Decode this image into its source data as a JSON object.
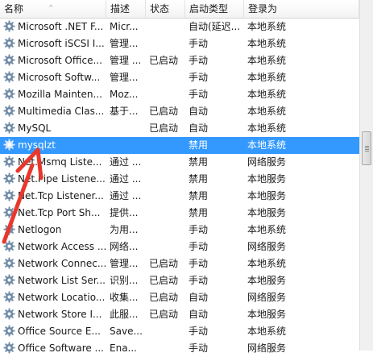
{
  "header": {
    "columns": [
      "名称",
      "描述",
      "状态",
      "启动类型",
      "登录为"
    ],
    "sort_indicator": "^"
  },
  "services": [
    {
      "name": "Microsoft .NET F...",
      "desc": "Micr...",
      "status": "",
      "startup": "自动(延迟...",
      "logon": "本地系统"
    },
    {
      "name": "Microsoft iSCSI I...",
      "desc": "管理...",
      "status": "",
      "startup": "手动",
      "logon": "本地系统"
    },
    {
      "name": "Microsoft Office...",
      "desc": "管理 ...",
      "status": "已启动",
      "startup": "手动",
      "logon": "本地系统"
    },
    {
      "name": "Microsoft Softw...",
      "desc": "管理...",
      "status": "",
      "startup": "手动",
      "logon": "本地系统"
    },
    {
      "name": "Mozilla Mainten...",
      "desc": "Moz...",
      "status": "",
      "startup": "手动",
      "logon": "本地系统"
    },
    {
      "name": "Multimedia Clas...",
      "desc": "基于...",
      "status": "已启动",
      "startup": "自动",
      "logon": "本地系统"
    },
    {
      "name": "MySQL",
      "desc": "",
      "status": "已启动",
      "startup": "自动",
      "logon": "本地系统"
    },
    {
      "name": "mysqlzt",
      "desc": "",
      "status": "",
      "startup": "禁用",
      "logon": "本地系统",
      "selected": true
    },
    {
      "name": "Net.Msmq Liste...",
      "desc": "通过 ...",
      "status": "",
      "startup": "禁用",
      "logon": "网络服务"
    },
    {
      "name": "Net.Pipe Listene...",
      "desc": "通过 ...",
      "status": "",
      "startup": "禁用",
      "logon": "本地服务"
    },
    {
      "name": "Net.Tcp Listener...",
      "desc": "通过 ...",
      "status": "",
      "startup": "禁用",
      "logon": "本地服务"
    },
    {
      "name": "Net.Tcp Port Sh...",
      "desc": "提供...",
      "status": "",
      "startup": "禁用",
      "logon": "本地服务"
    },
    {
      "name": "Netlogon",
      "desc": "为用...",
      "status": "",
      "startup": "手动",
      "logon": "本地系统"
    },
    {
      "name": "Network Access ...",
      "desc": "网络...",
      "status": "",
      "startup": "手动",
      "logon": "网络服务"
    },
    {
      "name": "Network Connec...",
      "desc": "管理...",
      "status": "已启动",
      "startup": "手动",
      "logon": "本地系统"
    },
    {
      "name": "Network List Ser...",
      "desc": "识别...",
      "status": "已启动",
      "startup": "手动",
      "logon": "本地服务"
    },
    {
      "name": "Network Locatio...",
      "desc": "收集...",
      "status": "已启动",
      "startup": "自动",
      "logon": "网络服务"
    },
    {
      "name": "Network Store I...",
      "desc": "此服...",
      "status": "已启动",
      "startup": "自动",
      "logon": "本地服务"
    },
    {
      "name": "Office  Source E...",
      "desc": "Save...",
      "status": "",
      "startup": "手动",
      "logon": "本地系统"
    },
    {
      "name": "Office Software ...",
      "desc": "Ena...",
      "status": "",
      "startup": "手动",
      "logon": "网络服务"
    }
  ],
  "colors": {
    "selection": "#3399ff",
    "annotation_arrow": "#e8382c",
    "gear_icon": "#6f8aa6"
  },
  "icons": {
    "service": "gear-icon",
    "annotation": "red-arrow-icon"
  }
}
